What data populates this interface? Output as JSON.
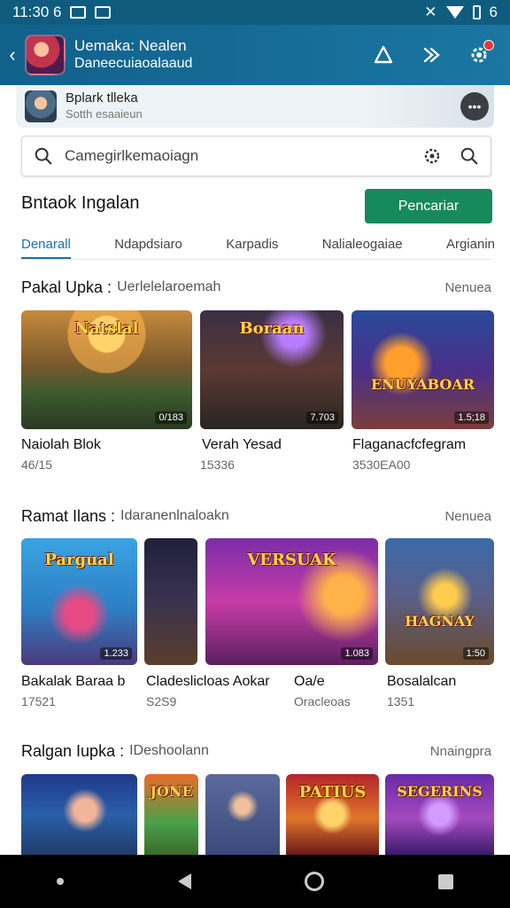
{
  "status_bar": {
    "time": "11:30 6",
    "signal": "6"
  },
  "app_bar": {
    "title": "Uemaka: Nealen",
    "subtitle": "Daneecuiaoalaaud"
  },
  "strip": {
    "title": "Bplark tlleka",
    "subtitle": "Sotth esaaieun"
  },
  "search": {
    "value": "Camegirlkemaoiagn"
  },
  "heading": "Bntaok Ingalan",
  "cta_label": "Pencariar",
  "tabs": [
    "Denarall",
    "Ndapdsiaro",
    "Karpadis",
    "Nalialeogaiae",
    "Argianin"
  ],
  "sections": [
    {
      "title": "Pakal Upka :",
      "subtitle": "Uerlelelaroemah",
      "more": "Nenuea",
      "cards": [
        {
          "caption": "Natslal",
          "tag": "0/183",
          "label": "Naiolah Blok",
          "meta": "46/15"
        },
        {
          "caption": "Boraan",
          "tag": "7.703",
          "label": "Verah Yesad",
          "meta": "15336"
        },
        {
          "caption": "ENUYABOAR",
          "tag": "1.5;18",
          "label": "Flaganacfcfegram",
          "meta": "3530EA00"
        }
      ]
    },
    {
      "title": "Ramat Ilans :",
      "subtitle": "Idaranenlnaloakn",
      "more": "Nenuea",
      "cards": [
        {
          "caption": "Pargual",
          "tag": "1.233",
          "label": "Bakalak Baraa b",
          "meta": "17521"
        },
        {
          "caption": "",
          "tag": "",
          "label": "",
          "meta": ""
        },
        {
          "caption": "VERSUAK",
          "tag": "1.083",
          "label": "Cladeslicloas   Aokar",
          "meta": "S2S9"
        },
        {
          "caption": "",
          "tag": "",
          "label": "Oa/e",
          "meta": "Oracleoas"
        },
        {
          "caption": "HAGNAY",
          "tag": "1:50",
          "label": "Bosalalcan",
          "meta": "1351"
        }
      ]
    },
    {
      "title": "Ralgan Iupka :",
      "subtitle": "IDeshoolann",
      "more": "Nnaingpra",
      "cards": [
        {
          "caption": "",
          "tag": ""
        },
        {
          "caption": "JONE",
          "tag": ""
        },
        {
          "caption": "",
          "tag": ""
        },
        {
          "caption": "PATIUS",
          "tag": ""
        },
        {
          "caption": "SEGERINS",
          "tag": ""
        }
      ]
    }
  ],
  "colors": {
    "app_bar": "#11618a",
    "cta": "#178a5b",
    "tab_active": "#1b6fb0"
  }
}
